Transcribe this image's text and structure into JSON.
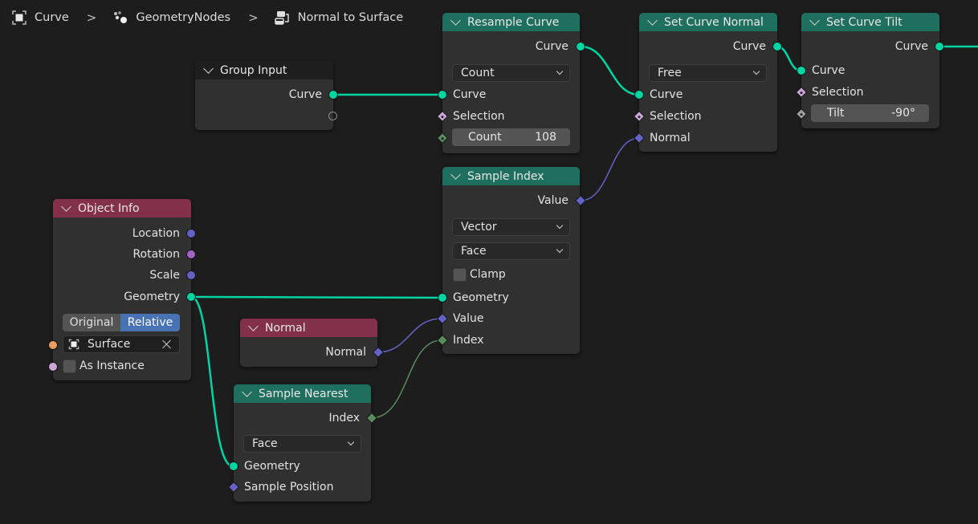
{
  "breadcrumb": {
    "items": [
      {
        "label": "Curve",
        "icon": "curve-object-icon"
      },
      {
        "label": "GeometryNodes",
        "icon": "geometry-nodes-modifier-icon"
      },
      {
        "label": "Normal to Surface",
        "icon": "node-tree-icon"
      }
    ],
    "separator": ">"
  },
  "colors": {
    "geometry_socket": "#00d6a3",
    "vector_socket": "#6363c7",
    "rotation_socket": "#a663c7",
    "boolean_socket": "#cca6d6",
    "integer_socket": "#598c5c",
    "float_socket": "#a1a1a1",
    "object_socket": "#ed9e5c",
    "geometry_node_header": "#1e6f5d",
    "input_node_header": "#83304b",
    "group_io_header": "#1e1e1e",
    "selected_toggle": "#4772b3"
  },
  "nodes": {
    "group_input": {
      "title": "Group Input",
      "outputs": [
        "Curve"
      ]
    },
    "resample_curve": {
      "title": "Resample Curve",
      "outputs": [
        "Curve"
      ],
      "mode": "Count",
      "inputs": [
        "Curve",
        "Selection"
      ],
      "count": {
        "label": "Count",
        "value": "108"
      }
    },
    "set_curve_normal": {
      "title": "Set Curve Normal",
      "outputs": [
        "Curve"
      ],
      "mode": "Free",
      "inputs": [
        "Curve",
        "Selection",
        "Normal"
      ]
    },
    "set_curve_tilt": {
      "title": "Set Curve Tilt",
      "outputs": [
        "Curve"
      ],
      "inputs": [
        "Curve",
        "Selection"
      ],
      "tilt": {
        "label": "Tilt",
        "value": "-90°"
      }
    },
    "sample_index": {
      "title": "Sample Index",
      "outputs": [
        "Value"
      ],
      "data_type": "Vector",
      "domain": "Face",
      "clamp": {
        "label": "Clamp",
        "checked": false
      },
      "inputs": [
        "Geometry",
        "Value",
        "Index"
      ]
    },
    "object_info": {
      "title": "Object Info",
      "outputs": [
        "Location",
        "Rotation",
        "Scale",
        "Geometry"
      ],
      "transform_space": {
        "options": [
          "Original",
          "Relative"
        ],
        "selected": "Relative"
      },
      "object": {
        "value": "Surface"
      },
      "as_instance": {
        "label": "As Instance",
        "checked": false
      }
    },
    "normal": {
      "title": "Normal",
      "outputs": [
        "Normal"
      ]
    },
    "sample_nearest": {
      "title": "Sample Nearest",
      "outputs": [
        "Index"
      ],
      "domain": "Face",
      "inputs": [
        "Geometry",
        "Sample Position"
      ]
    }
  }
}
